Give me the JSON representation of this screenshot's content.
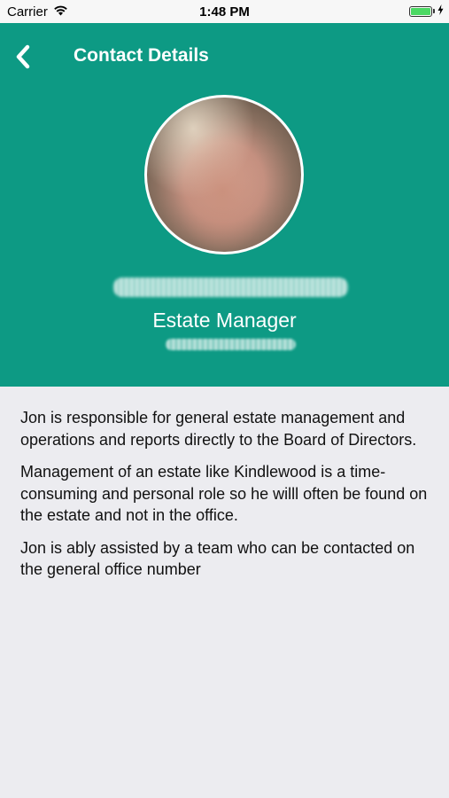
{
  "status_bar": {
    "carrier": "Carrier",
    "time": "1:48 PM",
    "battery_level": 1.0,
    "icons": [
      "wifi-icon",
      "battery-icon",
      "charging-bolt-icon"
    ]
  },
  "header": {
    "title": "Contact Details",
    "back_icon": "chevron-left-icon",
    "background_color": "#0d9a84",
    "job_title": "Estate Manager"
  },
  "description": {
    "paragraphs": [
      "Jon is responsible for general estate management and operations and reports directly to the Board of Directors.",
      "Management of an estate like Kindlewood is a time-consuming and personal role so he willl often be found on the estate and not in the office.",
      "Jon is ably assisted by a team who can be contacted on the general office number"
    ]
  }
}
